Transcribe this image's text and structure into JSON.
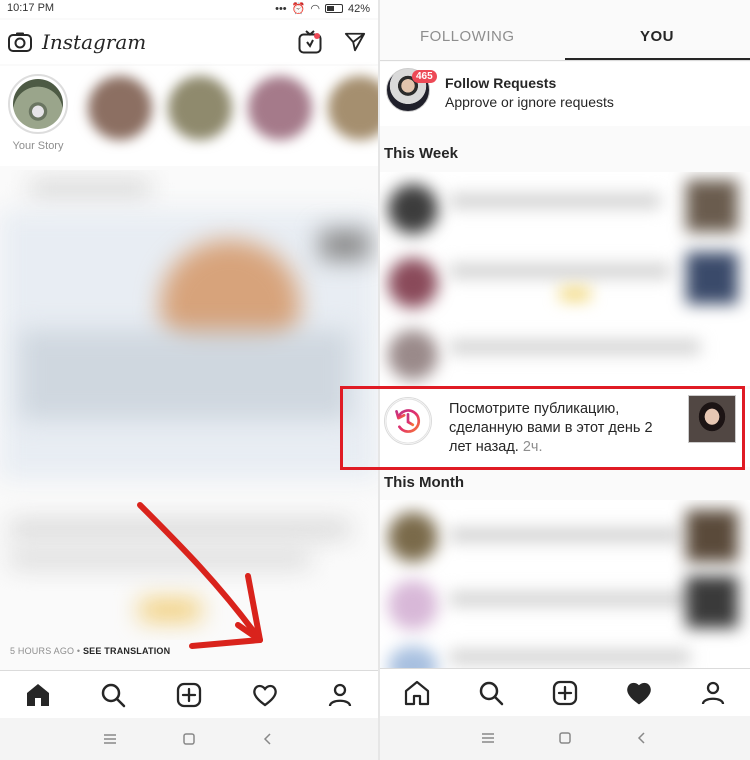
{
  "left": {
    "status_time": "10:17 PM",
    "status_battery": "42%",
    "logo": "Instagram",
    "your_story_label": "Your Story",
    "caption_time": "5 HOURS AGO",
    "caption_sep": " • ",
    "caption_link": "SEE TRANSLATION",
    "icons": {
      "camera": "camera-icon",
      "igtv": "igtv-icon",
      "direct": "direct-message-icon",
      "home": "home-icon",
      "search": "search-icon",
      "add": "add-post-icon",
      "activity": "heart-icon",
      "profile": "profile-icon"
    }
  },
  "right": {
    "tabs": [
      {
        "label": "FOLLOWING"
      },
      {
        "label": "YOU"
      }
    ],
    "follow_requests": {
      "title": "Follow Requests",
      "subtitle": "Approve or ignore requests",
      "badge": "465"
    },
    "sections": {
      "this_week": "This Week",
      "this_month": "This Month"
    },
    "memory": {
      "text": "Посмотрите публикацию, сделанную вами в этот день 2 лет назад.",
      "time": "2ч."
    }
  },
  "colors": {
    "highlight": "#e01b24",
    "badge": "#ed4956",
    "arrow": "#d9231c"
  }
}
